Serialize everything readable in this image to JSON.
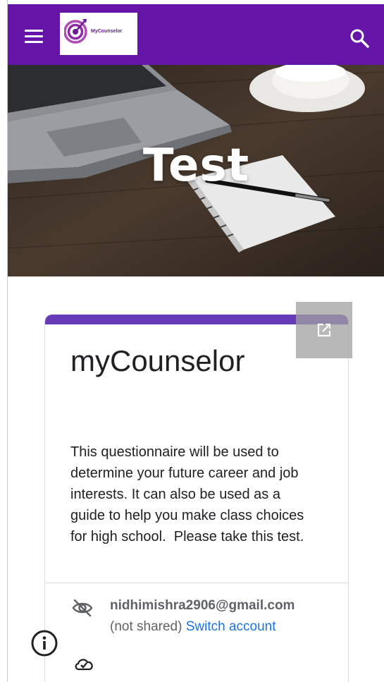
{
  "header": {
    "background_color": "#6515a8",
    "menu_icon": "hamburger-menu-icon",
    "logo_text": "MyCounselor",
    "search_icon": "search-icon"
  },
  "hero": {
    "title": "Test"
  },
  "form": {
    "accent_color": "#673ab7",
    "title": "myCounselor",
    "description": "This questionnaire will be used to determine your future career and job interests. It can also be used as a guide to help you make class choices for high school.  Please take this test.",
    "account_email": "nidhimishra2906@gmail.com",
    "not_shared": "(not shared)",
    "switch_account": "Switch account",
    "popout_icon": "open-in-new-icon",
    "hidden_icon": "eye-off-icon",
    "cloud_icon": "cloud-done-icon"
  },
  "footer": {
    "info_icon": "info-icon"
  }
}
